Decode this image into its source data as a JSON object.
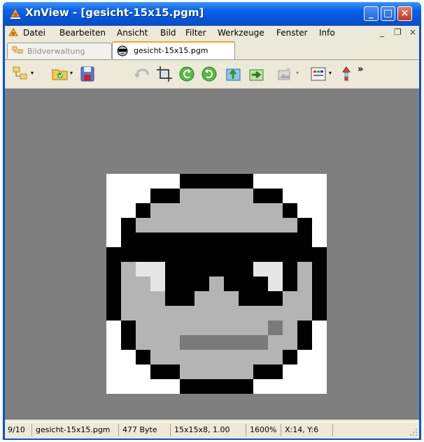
{
  "window": {
    "title": "XnView - [gesicht-15x15.pgm]",
    "buttons": {
      "minimize": "_",
      "maximize": "□",
      "close": "×"
    }
  },
  "menu": {
    "items": [
      "Datei",
      "Bearbeiten",
      "Ansicht",
      "Bild",
      "Filter",
      "Werkzeuge",
      "Fenster",
      "Info"
    ],
    "mdi_controls": {
      "minimize": "_",
      "restore": "❐",
      "close": "×"
    }
  },
  "tabs": [
    {
      "label": "Bildverwaltung",
      "active": false
    },
    {
      "label": "gesicht-15x15.pgm",
      "active": true
    }
  ],
  "toolbar": {
    "icons": [
      "browser-icon",
      "open-folder-icon",
      "save-icon",
      "undo-icon",
      "crop-icon",
      "rotate-left-icon",
      "rotate-right-icon",
      "export-icon",
      "convert-icon",
      "slideshow-icon",
      "adjust-icon",
      "effects-icon"
    ],
    "overflow": "»"
  },
  "image": {
    "name": "gesicht-15x15.pgm",
    "width": 15,
    "height": 15,
    "palette": {
      "0": "#ffffff",
      "1": "#000000",
      "2": "#b4b4b4",
      "3": "#e6e6e6",
      "4": "#7a7a7a"
    },
    "pixels": [
      "000001111100000",
      "000112222211000",
      "001222222222100",
      "012222222222210",
      "011111111111110",
      "111111111111111",
      "123311111133121",
      "122311121113121",
      "122211222111221",
      "122222222222221",
      "012222222224210",
      "012224444442210",
      "001222222222100",
      "000112222211000",
      "000001111100000"
    ]
  },
  "status": {
    "index": "9/10",
    "filename": "gesicht-15x15.pgm",
    "filesize": "477 Byte",
    "dimensions": "15x15x8, 1.00",
    "zoom": "1600%",
    "cursor": "X:14, Y:6"
  }
}
